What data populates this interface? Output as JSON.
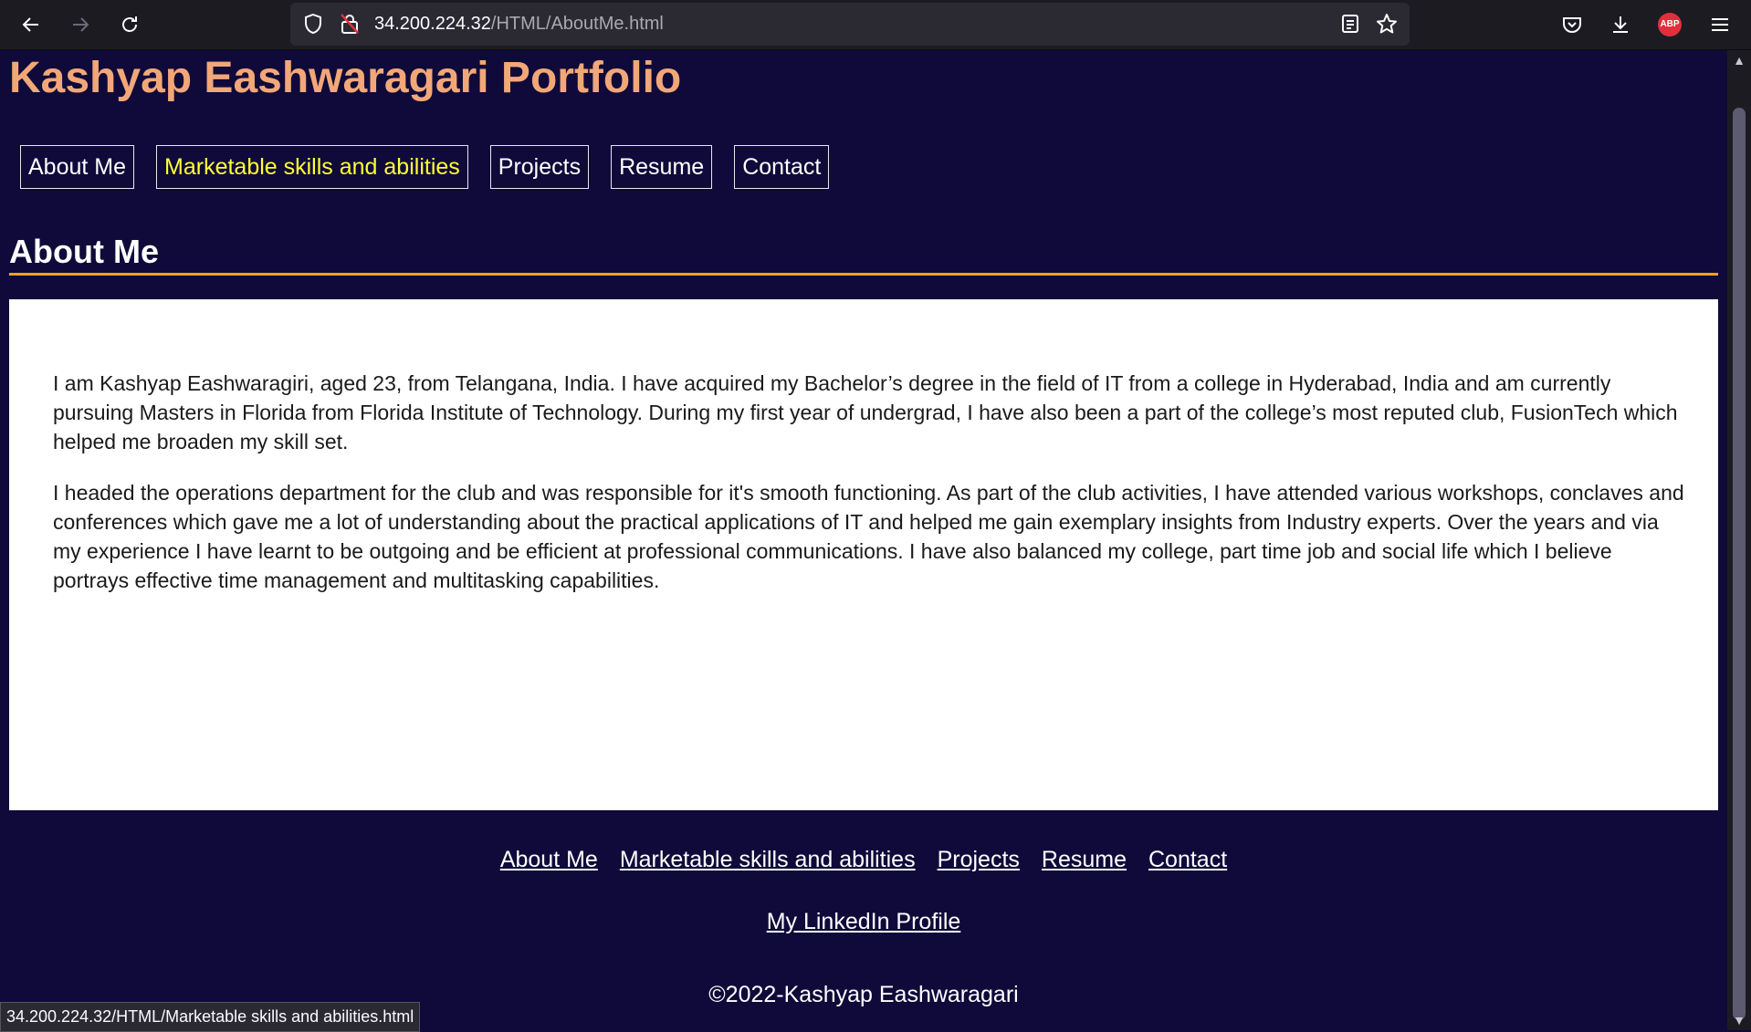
{
  "browser": {
    "url_host": "34.200.224.32",
    "url_path": "/HTML/AboutMe.html",
    "status_url": "34.200.224.32/HTML/Marketable skills and abilities.html",
    "icons": [
      "back-icon",
      "forward-icon",
      "reload-icon",
      "shield-icon",
      "lock-warning-icon",
      "reader-view-icon",
      "bookmark-star-icon",
      "pocket-icon",
      "download-icon",
      "adblock-plus-icon",
      "menu-icon"
    ],
    "abp_label": "ABP"
  },
  "site": {
    "title": "Kashyap Eashwaragari Portfolio",
    "colors": {
      "background": "#0f0a3a",
      "title": "#f2a778",
      "accent": "#f0a020",
      "active_nav": "#ffff33"
    }
  },
  "nav": {
    "items": [
      {
        "label": "About Me"
      },
      {
        "label": "Marketable skills and abilities"
      },
      {
        "label": "Projects"
      },
      {
        "label": "Resume"
      },
      {
        "label": "Contact"
      }
    ]
  },
  "main": {
    "heading": "About Me",
    "paragraphs": [
      "I am Kashyap Eashwaragiri, aged 23, from Telangana, India. I have acquired my Bachelor’s degree in the field of IT from a college in Hyderabad, India and am currently pursuing Masters in Florida from Florida Institute of Technology. During my first year of undergrad, I have also been a part of the college’s most reputed club, FusionTech which helped me broaden my skill set.",
      "I headed the operations department for the club and was responsible for it's smooth functioning. As part of the club activities, I have attended various workshops, conclaves and conferences which gave me a lot of understanding about the practical applications of IT and helped me gain exemplary insights from Industry experts. Over the years and via my experience I have learnt to be outgoing and be efficient at professional communications. I have also balanced my college, part time job and social life which I believe portrays effective time management and multitasking capabilities."
    ]
  },
  "footer": {
    "links": [
      {
        "label": "About Me"
      },
      {
        "label": "Marketable skills and abilities"
      },
      {
        "label": "Projects"
      },
      {
        "label": "Resume"
      },
      {
        "label": "Contact"
      }
    ],
    "linkedin": "My LinkedIn Profile",
    "copyright": "©2022-Kashyap Eashwaragari"
  }
}
